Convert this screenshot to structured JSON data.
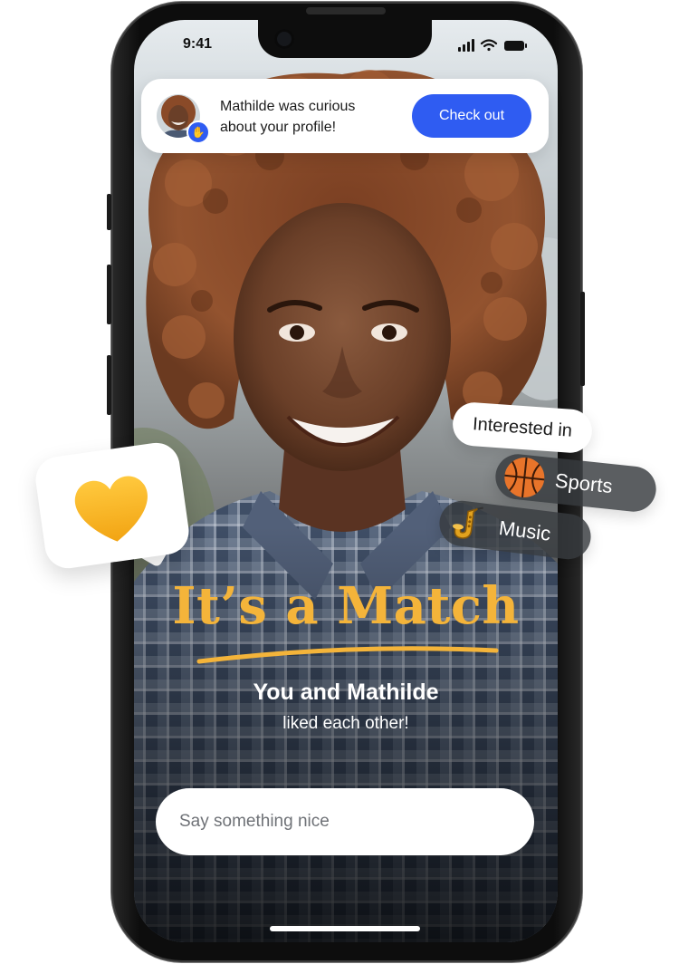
{
  "status_bar": {
    "time": "9:41"
  },
  "notification": {
    "message": "Mathilde was curious about your profile!",
    "action_label": "Check out"
  },
  "interests": {
    "label": "Interested in",
    "items": [
      {
        "emoji": "basketball-icon",
        "label": "Sports"
      },
      {
        "emoji": "saxophone-icon",
        "label": "Music"
      }
    ]
  },
  "match": {
    "title": "It’s a Match",
    "subtitle": "You and Mathilde",
    "caption": "liked each other!"
  },
  "message_input": {
    "placeholder": "Say something nice"
  },
  "colors": {
    "accent": "#f4b43a",
    "button": "#2f5cf2",
    "heart": "#f6b726"
  }
}
